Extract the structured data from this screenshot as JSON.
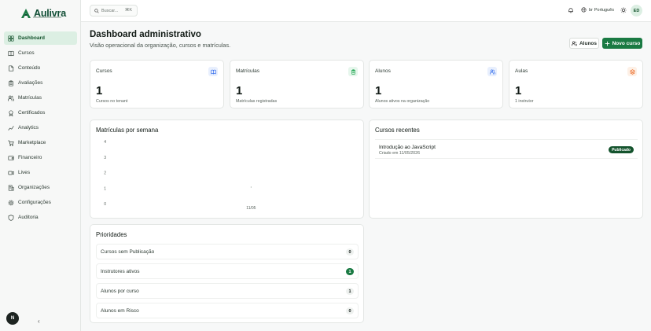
{
  "brand": {
    "name": "Aulivra"
  },
  "sidebar": {
    "items": [
      {
        "label": "Dashboard",
        "icon": "dashboard-icon",
        "active": true
      },
      {
        "label": "Cursos",
        "icon": "book-icon"
      },
      {
        "label": "Conteúdo",
        "icon": "file-icon"
      },
      {
        "label": "Avaliações",
        "icon": "clipboard-icon"
      },
      {
        "label": "Matrículas",
        "icon": "users-icon"
      },
      {
        "label": "Certificados",
        "icon": "award-icon"
      },
      {
        "label": "Analytics",
        "icon": "chart-icon"
      },
      {
        "label": "Marketplace",
        "icon": "cart-icon"
      },
      {
        "label": "Financeiro",
        "icon": "wallet-icon"
      },
      {
        "label": "Lives",
        "icon": "video-icon"
      },
      {
        "label": "Organizações",
        "icon": "building-icon"
      },
      {
        "label": "Configurações",
        "icon": "gear-icon"
      },
      {
        "label": "Auditoria",
        "icon": "shield-icon"
      }
    ],
    "user_initial": "N",
    "collapse_glyph": "‹"
  },
  "topbar": {
    "search_placeholder": "Buscar...",
    "search_shortcut": "⌘K",
    "language": "Português",
    "language_flag": "br",
    "avatar_initials": "ED"
  },
  "header": {
    "title": "Dashboard administrativo",
    "subtitle": "Visão operacional da organização, cursos e matrículas.",
    "btn_alunos": "Alunos",
    "btn_novo": "Novo curso"
  },
  "stats": [
    {
      "label": "Cursos",
      "value": "1",
      "caption": "Cursos no tenant",
      "icon": "book-icon",
      "color": "#2563eb",
      "bg": "#e8effd"
    },
    {
      "label": "Matrículas",
      "value": "1",
      "caption": "Matrículas registradas",
      "icon": "clipboard-icon",
      "color": "#16a34a",
      "bg": "#e6f6ec"
    },
    {
      "label": "Alunos",
      "value": "1",
      "caption": "Alunos ativos na organização",
      "icon": "users-icon",
      "color": "#2563eb",
      "bg": "#e8effd"
    },
    {
      "label": "Aulas",
      "value": "1",
      "caption": "1 instrutor",
      "icon": "layers-icon",
      "color": "#ea580c",
      "bg": "#fdf0e6"
    }
  ],
  "chart_panel": {
    "title": "Matrículas por semana"
  },
  "chart_data": {
    "type": "line",
    "x": [
      "11/05"
    ],
    "series": [
      {
        "values": [
          0
        ]
      }
    ],
    "yticks": [
      0,
      1,
      2,
      3,
      4
    ],
    "ylim": [
      0,
      4
    ]
  },
  "recent": {
    "title": "Cursos recentes",
    "items": [
      {
        "name": "Introdução ao JavaScript",
        "date": "Criado em 11/05/2026",
        "status": "Publicado"
      }
    ]
  },
  "priorities": {
    "title": "Prioridades",
    "items": [
      {
        "label": "Cursos sem Publicação",
        "count": "0",
        "highlight": false
      },
      {
        "label": "Instrutores ativos",
        "count": "1",
        "highlight": true
      },
      {
        "label": "Alunos por curso",
        "count": "1",
        "highlight": false
      },
      {
        "label": "Alunos em Risco",
        "count": "0",
        "highlight": false
      }
    ]
  }
}
